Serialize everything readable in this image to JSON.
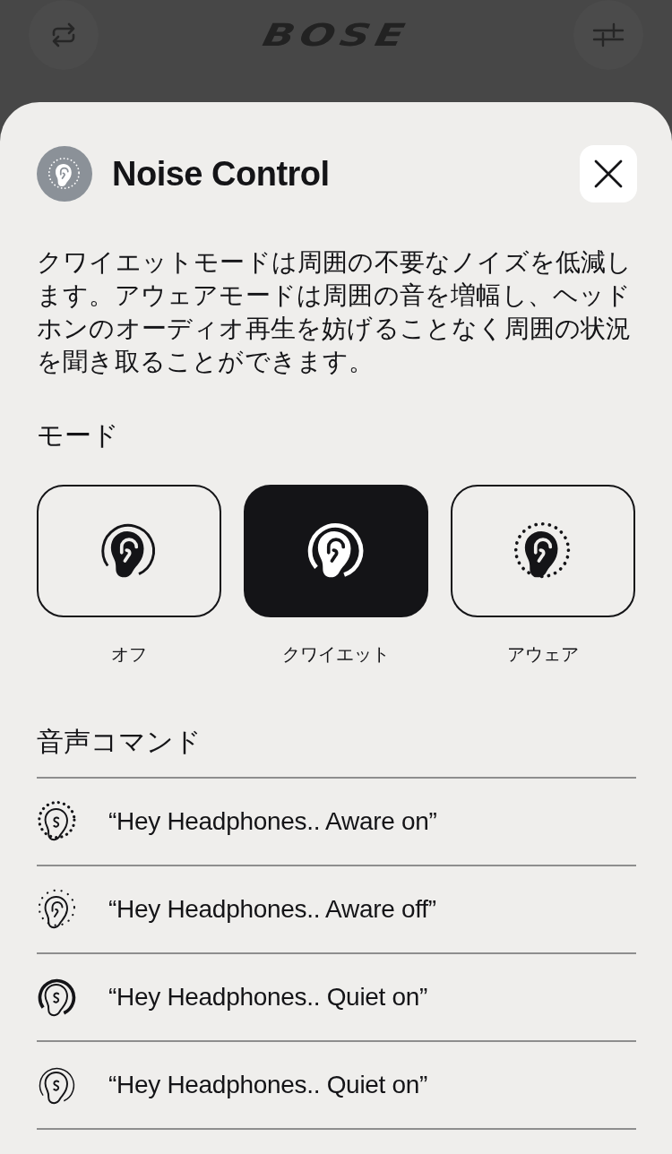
{
  "app_bar": {
    "logo": "BOSE"
  },
  "sheet": {
    "title": "Noise Control",
    "description": "クワイエットモードは周囲の不要なノイズを低減します。アウェアモードは周囲の音を増幅し、ヘッドホンのオーディオ再生を妨げることなく周囲の状況を聞き取ることができます。",
    "modes_heading": "モード",
    "modes": [
      {
        "label": "オフ",
        "kind": "off",
        "selected": false
      },
      {
        "label": "クワイエット",
        "kind": "quiet",
        "selected": true
      },
      {
        "label": "アウェア",
        "kind": "aware",
        "selected": false
      }
    ],
    "voice_heading": "音声コマンド",
    "voice_commands": [
      {
        "text": "“Hey Headphones.. Aware on”",
        "kind": "aware_on"
      },
      {
        "text": "“Hey Headphones.. Aware off”",
        "kind": "aware_off"
      },
      {
        "text": "“Hey Headphones.. Quiet on”",
        "kind": "quiet_on"
      },
      {
        "text": "“Hey Headphones.. Quiet on”",
        "kind": "quiet_light"
      }
    ]
  }
}
